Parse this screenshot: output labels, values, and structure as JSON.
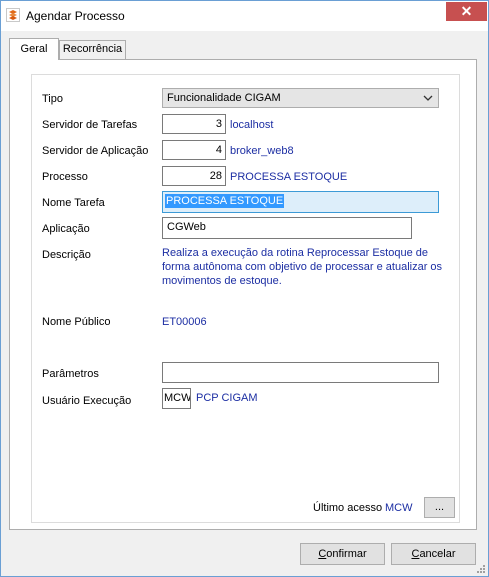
{
  "window": {
    "title": "Agendar Processo",
    "close_glyph": "✕"
  },
  "tabs": [
    {
      "label": "Geral",
      "active": true
    },
    {
      "label": "Recorrência",
      "active": false
    }
  ],
  "form": {
    "tipo": {
      "label": "Tipo",
      "value": "Funcionalidade CIGAM"
    },
    "servidor_tarefas": {
      "label": "Servidor de Tarefas",
      "code": "3",
      "name": "localhost"
    },
    "servidor_aplicacao": {
      "label": "Servidor de Aplicação",
      "code": "4",
      "name": "broker_web8"
    },
    "processo": {
      "label": "Processo",
      "code": "28",
      "name": "PROCESSA ESTOQUE"
    },
    "nome_tarefa": {
      "label": "Nome Tarefa",
      "value": "PROCESSA ESTOQUE"
    },
    "aplicacao": {
      "label": "Aplicação",
      "value": "CGWeb"
    },
    "descricao": {
      "label": "Descrição",
      "value": "Realiza a execução da rotina Reprocessar Estoque de forma autônoma com objetivo de processar e atualizar os movimentos de estoque."
    },
    "nome_publico": {
      "label": "Nome Público",
      "value": "ET00006"
    },
    "parametros": {
      "label": "Parâmetros",
      "value": ""
    },
    "usuario_execucao": {
      "label": "Usuário Execução",
      "code": "MCW",
      "name": "PCP CIGAM"
    },
    "ultimo_acesso": {
      "label": "Último acesso",
      "value": "MCW",
      "button": "..."
    }
  },
  "buttons": {
    "confirmar": {
      "first": "C",
      "rest": "onfirmar"
    },
    "cancelar": {
      "first": "C",
      "rest": "ancelar"
    }
  },
  "icons": {
    "app": "cigam-app-icon",
    "close": "close-icon",
    "dropdown": "chevron-down-icon"
  },
  "colors": {
    "value_text": "#1c2ea3",
    "close_button": "#c75050",
    "selection": "#3399ff",
    "focus_border": "#3c9ad6"
  }
}
